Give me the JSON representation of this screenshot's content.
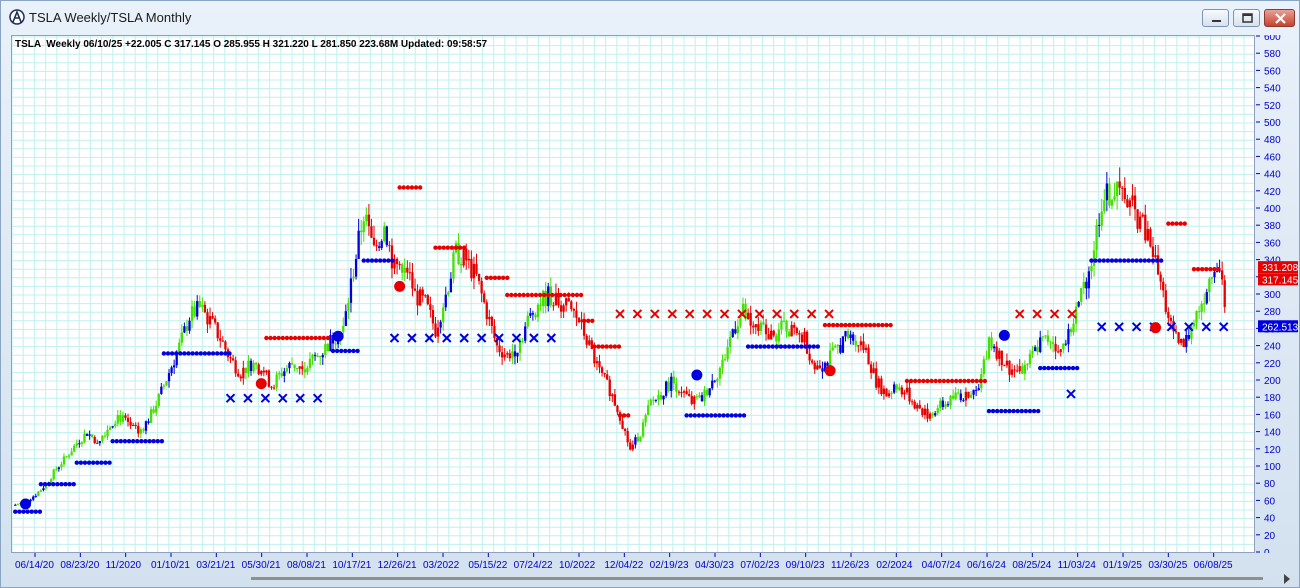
{
  "window": {
    "title": "TSLA  Weekly/TSLA  Monthly"
  },
  "header": {
    "info": "TSLA  Weekly 06/10/25 +22.005 C 317.145 O 285.955 H 321.220 L 281.850 223.68M Updated: 09:58:57"
  },
  "colors": {
    "up": "#44e000",
    "down": "#e80000",
    "trend_up": "#0000e0",
    "grid": "#bff0f0",
    "axis_text": "#0000cc"
  },
  "chart_data": {
    "type": "candlestick",
    "title": "",
    "xlabel": "",
    "ylabel": "",
    "ylim": [
      0,
      600
    ],
    "yticks": [
      0,
      20,
      40,
      60,
      80,
      100,
      120,
      140,
      160,
      180,
      200,
      220,
      240,
      260,
      280,
      300,
      320,
      340,
      360,
      380,
      400,
      420,
      440,
      460,
      480,
      500,
      520,
      540,
      560,
      580,
      600
    ],
    "grid": true,
    "xtick_labels": [
      "06/14/20",
      "08/23/20",
      "11/2020",
      "01/10/21",
      "03/21/21",
      "05/30/21",
      "08/08/21",
      "10/17/21",
      "12/26/21",
      "03/2022",
      "05/15/22",
      "07/24/22",
      "10/2022",
      "12/04/22",
      "02/19/23",
      "04/30/23",
      "07/02/23",
      "09/10/23",
      "11/26/23",
      "02/2024",
      "04/07/24",
      "06/16/24",
      "08/25/24",
      "11/03/24",
      "01/19/25",
      "03/30/25",
      "06/08/25"
    ],
    "price_labels": [
      {
        "text": "331.208",
        "value": 331.2,
        "color": "#e80000"
      },
      {
        "text": "317.145",
        "value": 317.1,
        "color": "#e80000"
      },
      {
        "text": "262.513",
        "value": 262.5,
        "color": "#0000e0"
      }
    ],
    "weekly_close_path": [
      [
        0,
        56
      ],
      [
        4,
        60
      ],
      [
        8,
        68
      ],
      [
        12,
        80
      ],
      [
        16,
        98
      ],
      [
        20,
        112
      ],
      [
        24,
        128
      ],
      [
        28,
        140
      ],
      [
        32,
        130
      ],
      [
        36,
        145
      ],
      [
        40,
        160
      ],
      [
        44,
        150
      ],
      [
        48,
        140
      ],
      [
        52,
        155
      ],
      [
        56,
        180
      ],
      [
        60,
        210
      ],
      [
        64,
        240
      ],
      [
        68,
        275
      ],
      [
        72,
        285
      ],
      [
        76,
        270
      ],
      [
        80,
        250
      ],
      [
        84,
        225
      ],
      [
        88,
        210
      ],
      [
        92,
        220
      ],
      [
        96,
        215
      ],
      [
        100,
        195
      ],
      [
        104,
        210
      ],
      [
        108,
        220
      ],
      [
        112,
        215
      ],
      [
        116,
        225
      ],
      [
        120,
        235
      ],
      [
        124,
        250
      ],
      [
        128,
        260
      ],
      [
        132,
        330
      ],
      [
        136,
        395
      ],
      [
        140,
        350
      ],
      [
        144,
        380
      ],
      [
        148,
        330
      ],
      [
        152,
        340
      ],
      [
        156,
        300
      ],
      [
        160,
        290
      ],
      [
        164,
        260
      ],
      [
        168,
        300
      ],
      [
        172,
        350
      ],
      [
        176,
        340
      ],
      [
        180,
        320
      ],
      [
        184,
        280
      ],
      [
        188,
        240
      ],
      [
        192,
        230
      ],
      [
        196,
        240
      ],
      [
        200,
        270
      ],
      [
        204,
        290
      ],
      [
        208,
        300
      ],
      [
        212,
        290
      ],
      [
        216,
        285
      ],
      [
        220,
        270
      ],
      [
        224,
        240
      ],
      [
        228,
        210
      ],
      [
        232,
        190
      ],
      [
        236,
        160
      ],
      [
        240,
        120
      ],
      [
        244,
        140
      ],
      [
        248,
        175
      ],
      [
        252,
        185
      ],
      [
        256,
        200
      ],
      [
        260,
        190
      ],
      [
        264,
        175
      ],
      [
        268,
        180
      ],
      [
        272,
        200
      ],
      [
        276,
        220
      ],
      [
        280,
        260
      ],
      [
        284,
        280
      ],
      [
        288,
        260
      ],
      [
        292,
        260
      ],
      [
        296,
        250
      ],
      [
        300,
        265
      ],
      [
        304,
        255
      ],
      [
        308,
        250
      ],
      [
        312,
        215
      ],
      [
        316,
        220
      ],
      [
        320,
        235
      ],
      [
        324,
        250
      ],
      [
        328,
        250
      ],
      [
        332,
        235
      ],
      [
        336,
        200
      ],
      [
        340,
        185
      ],
      [
        344,
        195
      ],
      [
        348,
        185
      ],
      [
        352,
        170
      ],
      [
        356,
        160
      ],
      [
        360,
        170
      ],
      [
        364,
        175
      ],
      [
        368,
        185
      ],
      [
        372,
        180
      ],
      [
        376,
        190
      ],
      [
        380,
        250
      ],
      [
        384,
        230
      ],
      [
        388,
        215
      ],
      [
        392,
        210
      ],
      [
        396,
        225
      ],
      [
        400,
        245
      ],
      [
        404,
        250
      ],
      [
        408,
        235
      ],
      [
        412,
        260
      ],
      [
        416,
        300
      ],
      [
        420,
        340
      ],
      [
        424,
        410
      ],
      [
        428,
        420
      ],
      [
        432,
        415
      ],
      [
        436,
        400
      ],
      [
        440,
        380
      ],
      [
        444,
        350
      ],
      [
        448,
        300
      ],
      [
        452,
        250
      ],
      [
        456,
        240
      ],
      [
        460,
        270
      ],
      [
        464,
        300
      ],
      [
        468,
        340
      ],
      [
        472,
        317
      ]
    ],
    "weekly_bars": 473,
    "monthly_trend_steps": [
      {
        "from": 0,
        "to": 10,
        "value": 48,
        "side": "support",
        "marker": "dot"
      },
      {
        "from": 10,
        "to": 24,
        "value": 80,
        "side": "support",
        "marker": "dot"
      },
      {
        "from": 24,
        "to": 38,
        "value": 105,
        "side": "support",
        "marker": "dot"
      },
      {
        "from": 38,
        "to": 58,
        "value": 130,
        "side": "support",
        "marker": "dot"
      },
      {
        "from": 58,
        "to": 84,
        "value": 232,
        "side": "support",
        "marker": "dot"
      },
      {
        "from": 84,
        "to": 120,
        "value": 180,
        "side": "support",
        "marker": "x"
      },
      {
        "from": 124,
        "to": 134,
        "value": 235,
        "side": "support",
        "marker": "dot"
      },
      {
        "from": 136,
        "to": 148,
        "value": 340,
        "side": "support",
        "marker": "dot"
      },
      {
        "from": 148,
        "to": 216,
        "value": 250,
        "side": "support",
        "marker": "x"
      },
      {
        "from": 98,
        "to": 122,
        "value": 250,
        "side": "resistance",
        "marker": "dot"
      },
      {
        "from": 150,
        "to": 158,
        "value": 425,
        "side": "resistance",
        "marker": "dot"
      },
      {
        "from": 164,
        "to": 176,
        "value": 355,
        "side": "resistance",
        "marker": "dot"
      },
      {
        "from": 184,
        "to": 192,
        "value": 320,
        "side": "resistance",
        "marker": "dot"
      },
      {
        "from": 192,
        "to": 222,
        "value": 300,
        "side": "resistance",
        "marker": "dot"
      },
      {
        "from": 222,
        "to": 226,
        "value": 270,
        "side": "resistance",
        "marker": "dot"
      },
      {
        "from": 226,
        "to": 236,
        "value": 240,
        "side": "resistance",
        "marker": "dot"
      },
      {
        "from": 236,
        "to": 240,
        "value": 160,
        "side": "resistance",
        "marker": "dot"
      },
      {
        "from": 236,
        "to": 318,
        "value": 278,
        "side": "resistance",
        "marker": "x"
      },
      {
        "from": 262,
        "to": 286,
        "value": 160,
        "side": "support",
        "marker": "dot"
      },
      {
        "from": 286,
        "to": 314,
        "value": 240,
        "side": "support",
        "marker": "dot"
      },
      {
        "from": 316,
        "to": 342,
        "value": 265,
        "side": "resistance",
        "marker": "dot"
      },
      {
        "from": 348,
        "to": 380,
        "value": 200,
        "side": "resistance",
        "marker": "dot"
      },
      {
        "from": 380,
        "to": 400,
        "value": 165,
        "side": "support",
        "marker": "dot"
      },
      {
        "from": 392,
        "to": 416,
        "value": 278,
        "side": "resistance",
        "marker": "x"
      },
      {
        "from": 400,
        "to": 416,
        "value": 215,
        "side": "support",
        "marker": "dot"
      },
      {
        "from": 412,
        "to": 416,
        "value": 185,
        "side": "support",
        "marker": "x"
      },
      {
        "from": 420,
        "to": 448,
        "value": 340,
        "side": "support",
        "marker": "dot"
      },
      {
        "from": 424,
        "to": 472,
        "value": 263,
        "side": "support",
        "marker": "x"
      },
      {
        "from": 450,
        "to": 458,
        "value": 383,
        "side": "resistance",
        "marker": "dot"
      },
      {
        "from": 460,
        "to": 470,
        "value": 330,
        "side": "resistance",
        "marker": "dot"
      }
    ],
    "reversal_markers": [
      {
        "bar": 4,
        "value": 57,
        "color": "blue"
      },
      {
        "bar": 96,
        "value": 197,
        "color": "red"
      },
      {
        "bar": 126,
        "value": 252,
        "color": "blue"
      },
      {
        "bar": 150,
        "value": 310,
        "color": "red"
      },
      {
        "bar": 266,
        "value": 207,
        "color": "blue"
      },
      {
        "bar": 318,
        "value": 212,
        "color": "red"
      },
      {
        "bar": 386,
        "value": 253,
        "color": "blue"
      },
      {
        "bar": 445,
        "value": 262,
        "color": "red"
      }
    ]
  }
}
